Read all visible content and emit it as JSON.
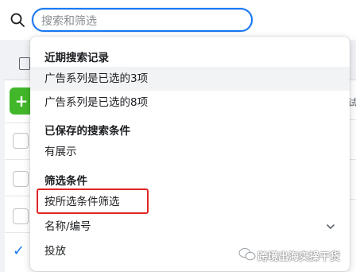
{
  "search": {
    "placeholder": "搜索和筛选"
  },
  "background": {
    "add_label": "+",
    "right_edge_text": "试"
  },
  "dropdown": {
    "recent_header": "近期搜索记录",
    "recent_items": [
      {
        "label": "广告系列是已选的3项"
      },
      {
        "label": "广告系列是已选的8项"
      }
    ],
    "saved_header": "已保存的搜索条件",
    "saved_items": [
      {
        "label": "有展示"
      }
    ],
    "filter_header": "筛选条件",
    "filter_items": [
      {
        "label": "按所选条件筛选"
      },
      {
        "label": "名称/编号"
      },
      {
        "label": "投放"
      }
    ]
  },
  "watermark": {
    "text": "跨境出海实操干货"
  },
  "colors": {
    "accent": "#1877f2",
    "highlight": "#e02424",
    "add_button": "#42b72a"
  }
}
